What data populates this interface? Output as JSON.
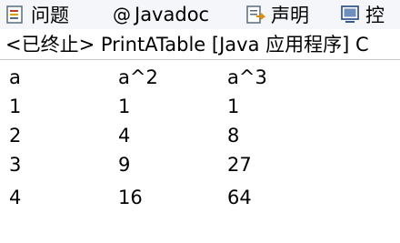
{
  "tabs": [
    {
      "label": "问题",
      "icon": "problems-icon"
    },
    {
      "label": "Javadoc",
      "icon": "at-icon"
    },
    {
      "label": "声明",
      "icon": "declaration-icon"
    },
    {
      "label": "控",
      "icon": "console-icon"
    }
  ],
  "console": {
    "header": "<已终止> PrintATable [Java 应用程序] C",
    "rows": [
      [
        "a",
        "a^2",
        "a^3"
      ],
      [
        "1",
        "1",
        "1"
      ],
      [
        "2",
        "4",
        "8"
      ],
      [
        "3",
        "9",
        "27"
      ],
      [
        "4",
        "16",
        "64"
      ]
    ]
  }
}
